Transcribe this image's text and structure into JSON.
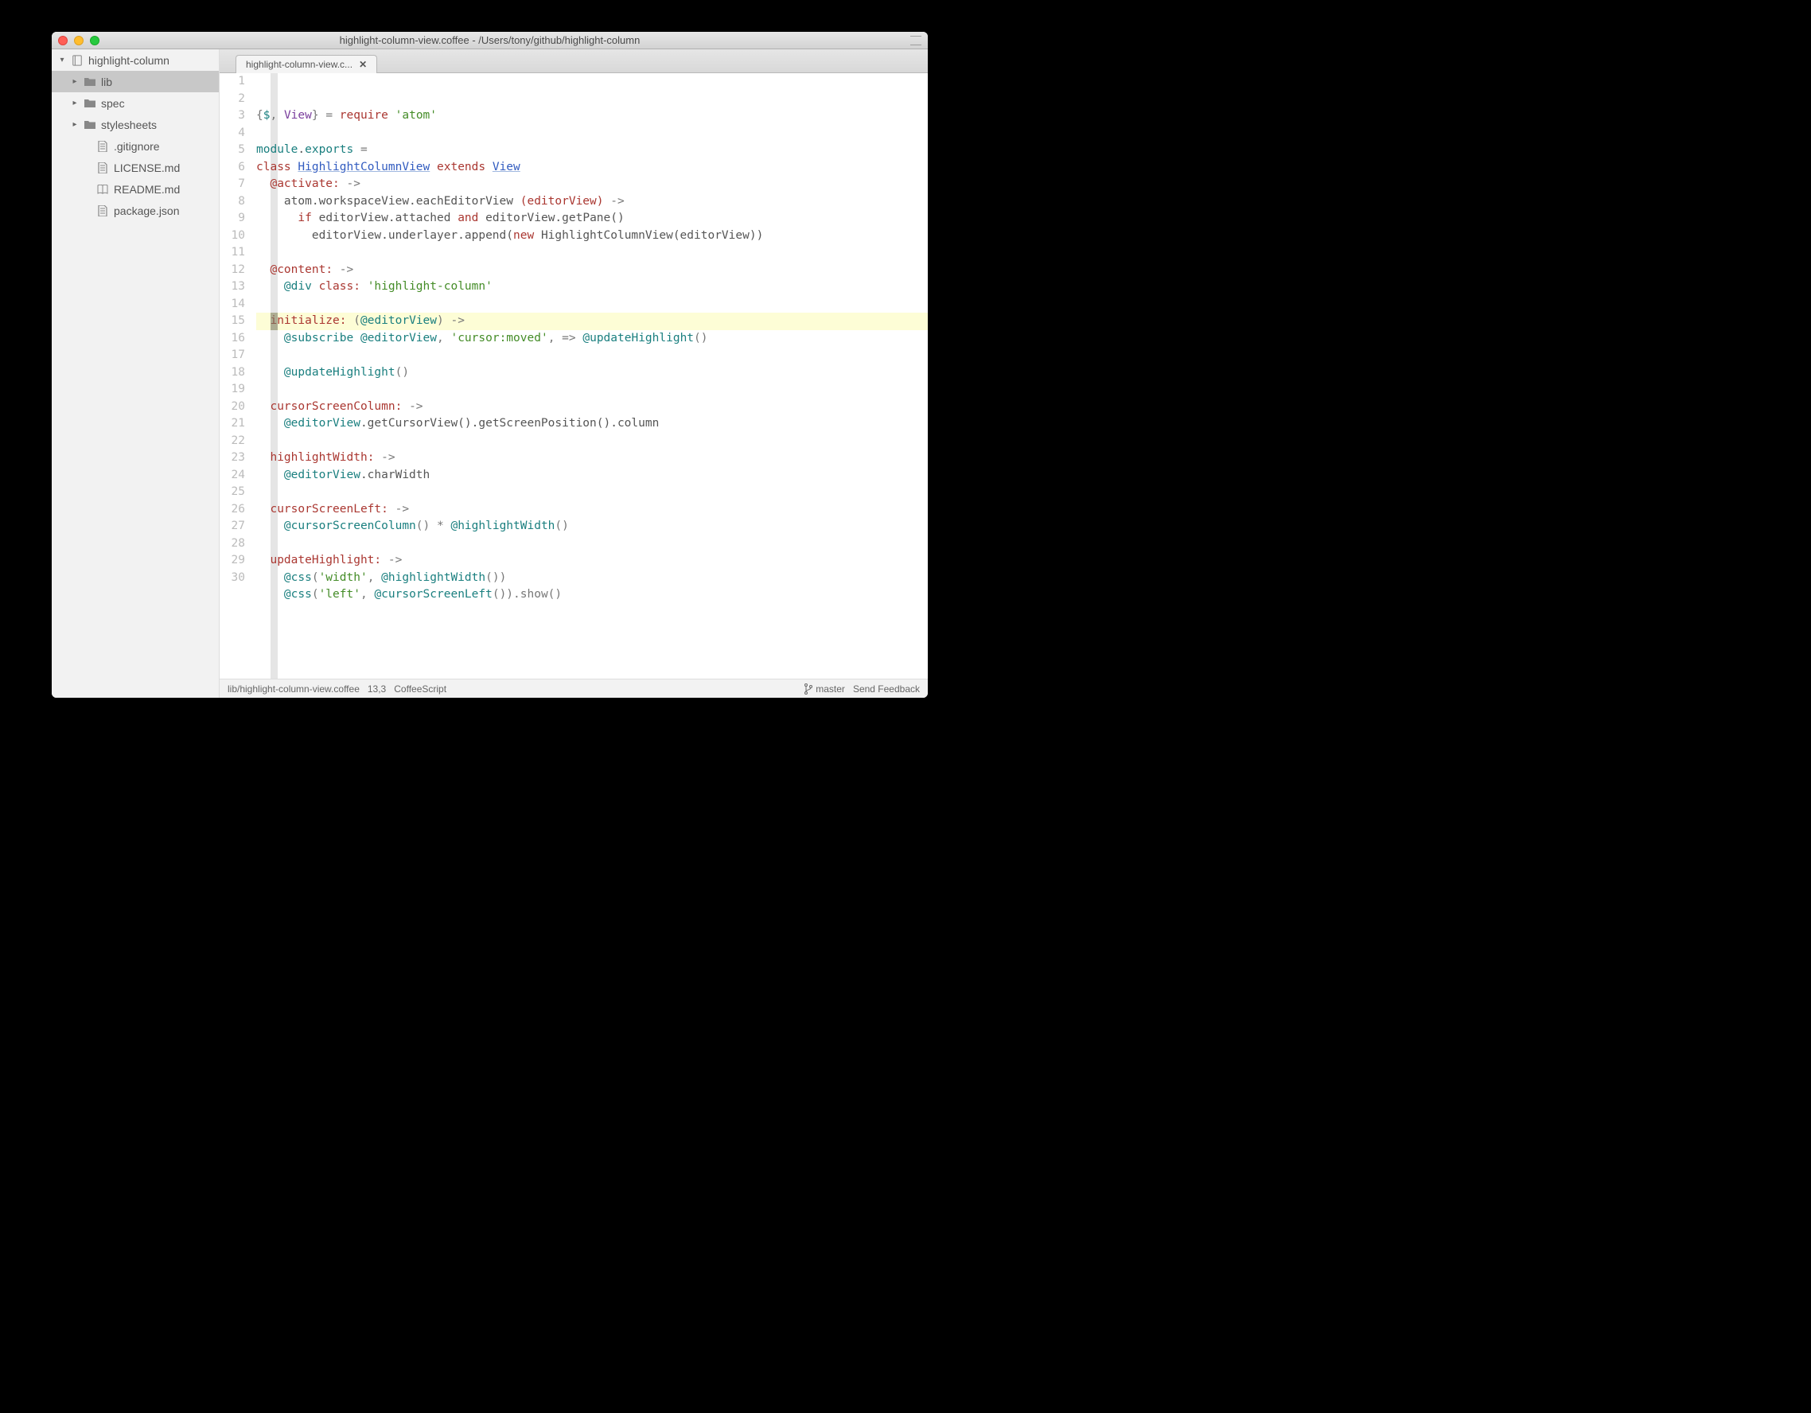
{
  "window": {
    "title": "highlight-column-view.coffee - /Users/tony/github/highlight-column"
  },
  "sidebar": {
    "root": "highlight-column",
    "items": [
      {
        "label": "lib",
        "type": "folder",
        "selected": true,
        "expandable": true
      },
      {
        "label": "spec",
        "type": "folder",
        "selected": false,
        "expandable": true
      },
      {
        "label": "stylesheets",
        "type": "folder",
        "selected": false,
        "expandable": true
      },
      {
        "label": ".gitignore",
        "type": "file"
      },
      {
        "label": "LICENSE.md",
        "type": "file"
      },
      {
        "label": "README.md",
        "type": "book"
      },
      {
        "label": "package.json",
        "type": "file"
      }
    ]
  },
  "tabs": {
    "active": {
      "label": "highlight-column-view.c..."
    }
  },
  "statusbar": {
    "path": "lib/highlight-column-view.coffee",
    "cursor": "13,3",
    "language": "CoffeeScript",
    "branch": "master",
    "feedback": "Send Feedback"
  },
  "editor": {
    "highlighted_line": 13,
    "lines": [
      [
        [
          "sym",
          "{"
        ],
        [
          "id",
          "$"
        ],
        [
          "sym",
          ", "
        ],
        [
          "fn",
          "View"
        ],
        [
          "sym",
          "} = "
        ],
        [
          "kw",
          "require"
        ],
        [
          "plain",
          " "
        ],
        [
          "str",
          "'atom'"
        ]
      ],
      [],
      [
        [
          "id",
          "module"
        ],
        [
          "plain",
          "."
        ],
        [
          "id",
          "exports"
        ],
        [
          "sym",
          " ="
        ]
      ],
      [
        [
          "kw",
          "class"
        ],
        [
          "plain",
          " "
        ],
        [
          "cls",
          "HighlightColumnView"
        ],
        [
          "plain",
          " "
        ],
        [
          "kw",
          "extends"
        ],
        [
          "plain",
          " "
        ],
        [
          "cls",
          "View"
        ]
      ],
      [
        [
          "plain",
          "  "
        ],
        [
          "at",
          "@activate"
        ],
        [
          "kw",
          ":"
        ],
        [
          "plain",
          " "
        ],
        [
          "op",
          "->"
        ]
      ],
      [
        [
          "plain",
          "    atom.workspaceView.eachEditorView "
        ],
        [
          "at",
          "(editorView)"
        ],
        [
          "plain",
          " "
        ],
        [
          "op",
          "->"
        ]
      ],
      [
        [
          "plain",
          "      "
        ],
        [
          "kw",
          "if"
        ],
        [
          "plain",
          " editorView.attached "
        ],
        [
          "kw",
          "and"
        ],
        [
          "plain",
          " editorView.getPane()"
        ]
      ],
      [
        [
          "plain",
          "        editorView.underlayer.append("
        ],
        [
          "kw",
          "new"
        ],
        [
          "plain",
          " HighlightColumnView(editorView))"
        ]
      ],
      [],
      [
        [
          "plain",
          "  "
        ],
        [
          "at",
          "@content"
        ],
        [
          "kw",
          ":"
        ],
        [
          "plain",
          " "
        ],
        [
          "op",
          "->"
        ]
      ],
      [
        [
          "plain",
          "    "
        ],
        [
          "id",
          "@div"
        ],
        [
          "plain",
          " "
        ],
        [
          "at",
          "class"
        ],
        [
          "kw",
          ":"
        ],
        [
          "plain",
          " "
        ],
        [
          "str",
          "'highlight-column'"
        ]
      ],
      [],
      [
        [
          "plain",
          "  "
        ],
        [
          "at",
          "initialize"
        ],
        [
          "kw",
          ":"
        ],
        [
          "plain",
          " "
        ],
        [
          "sym",
          "("
        ],
        [
          "id",
          "@editorView"
        ],
        [
          "sym",
          ")"
        ],
        [
          "plain",
          " "
        ],
        [
          "op",
          "->"
        ]
      ],
      [
        [
          "plain",
          "    "
        ],
        [
          "id",
          "@subscribe"
        ],
        [
          "plain",
          " "
        ],
        [
          "id",
          "@editorView"
        ],
        [
          "sym",
          ", "
        ],
        [
          "str",
          "'cursor:moved'"
        ],
        [
          "sym",
          ", "
        ],
        [
          "op",
          "=>"
        ],
        [
          "plain",
          " "
        ],
        [
          "id",
          "@updateHighlight"
        ],
        [
          "sym",
          "()"
        ]
      ],
      [],
      [
        [
          "plain",
          "    "
        ],
        [
          "id",
          "@updateHighlight"
        ],
        [
          "sym",
          "()"
        ]
      ],
      [],
      [
        [
          "plain",
          "  "
        ],
        [
          "at",
          "cursorScreenColumn"
        ],
        [
          "kw",
          ":"
        ],
        [
          "plain",
          " "
        ],
        [
          "op",
          "->"
        ]
      ],
      [
        [
          "plain",
          "    "
        ],
        [
          "id",
          "@editorView"
        ],
        [
          "plain",
          ".getCursorView().getScreenPosition().column"
        ]
      ],
      [],
      [
        [
          "plain",
          "  "
        ],
        [
          "at",
          "highlightWidth"
        ],
        [
          "kw",
          ":"
        ],
        [
          "plain",
          " "
        ],
        [
          "op",
          "->"
        ]
      ],
      [
        [
          "plain",
          "    "
        ],
        [
          "id",
          "@editorView"
        ],
        [
          "plain",
          ".charWidth"
        ]
      ],
      [],
      [
        [
          "plain",
          "  "
        ],
        [
          "at",
          "cursorScreenLeft"
        ],
        [
          "kw",
          ":"
        ],
        [
          "plain",
          " "
        ],
        [
          "op",
          "->"
        ]
      ],
      [
        [
          "plain",
          "    "
        ],
        [
          "id",
          "@cursorScreenColumn"
        ],
        [
          "sym",
          "() "
        ],
        [
          "op",
          "*"
        ],
        [
          "plain",
          " "
        ],
        [
          "id",
          "@highlightWidth"
        ],
        [
          "sym",
          "()"
        ]
      ],
      [],
      [
        [
          "plain",
          "  "
        ],
        [
          "at",
          "updateHighlight"
        ],
        [
          "kw",
          ":"
        ],
        [
          "plain",
          " "
        ],
        [
          "op",
          "->"
        ]
      ],
      [
        [
          "plain",
          "    "
        ],
        [
          "id",
          "@css"
        ],
        [
          "sym",
          "("
        ],
        [
          "str",
          "'width'"
        ],
        [
          "sym",
          ", "
        ],
        [
          "id",
          "@highlightWidth"
        ],
        [
          "sym",
          "())"
        ]
      ],
      [
        [
          "plain",
          "    "
        ],
        [
          "id",
          "@css"
        ],
        [
          "sym",
          "("
        ],
        [
          "str",
          "'left'"
        ],
        [
          "sym",
          ", "
        ],
        [
          "id",
          "@cursorScreenLeft"
        ],
        [
          "sym",
          "()).show()"
        ]
      ],
      []
    ]
  }
}
